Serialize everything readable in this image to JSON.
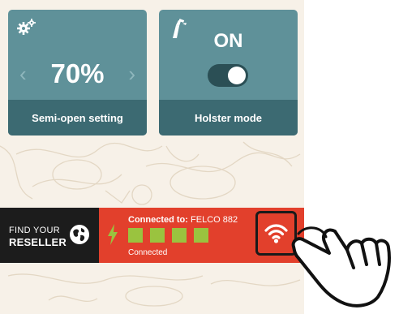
{
  "cards": {
    "semi_open": {
      "value": "70%",
      "label": "Semi-open setting",
      "prev_arrow": "‹",
      "next_arrow": "›",
      "icon": "gears-icon"
    },
    "holster": {
      "state": "ON",
      "label": "Holster mode",
      "toggle_on": true,
      "icon": "holster-icon"
    }
  },
  "bottom_bar": {
    "reseller": {
      "line1": "FIND YOUR",
      "line2": "RESELLER",
      "icon": "globe-icon"
    },
    "status": {
      "connected_to_label": "Connected to:",
      "device": "FELCO 882",
      "signal_squares": 4,
      "status_text": "Connected",
      "icon": "lightning-bolt-icon"
    },
    "wifi_button_icon": "wifi-icon"
  },
  "colors": {
    "card_bg": "#5f9199",
    "card_footer": "#3c6a72",
    "status_red": "#e2402c",
    "square_green": "#9ac33f",
    "reseller_dark": "#1c1c1c",
    "bolt_green": "#9ac33f"
  }
}
